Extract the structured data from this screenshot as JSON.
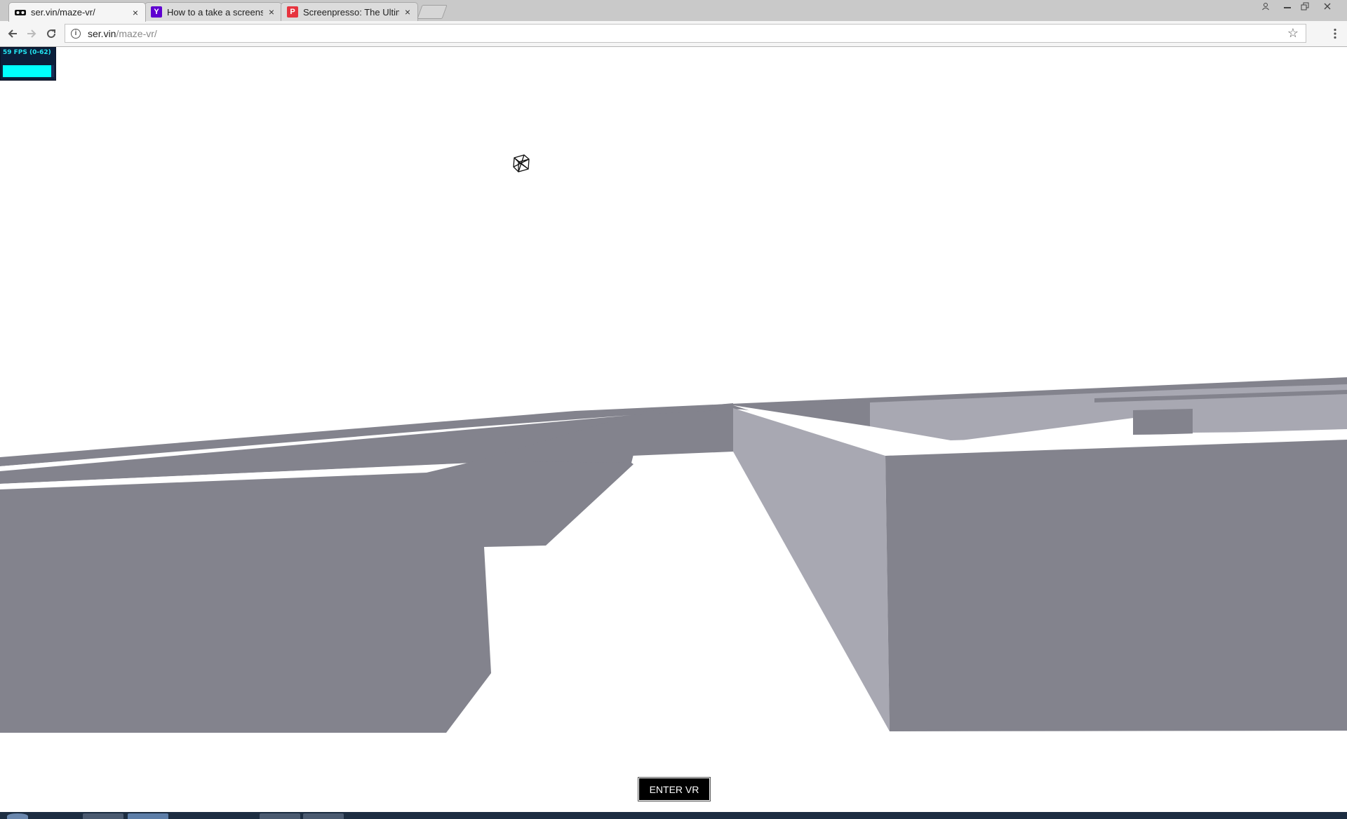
{
  "browser": {
    "tabs": [
      {
        "title": "ser.vin/maze-vr/",
        "favicon": "vr-goggles-icon",
        "active": true
      },
      {
        "title": "How to a take a screensh",
        "favicon": "yahoo-icon",
        "favicon_glyph": "Y",
        "favicon_color": "#5f01d1",
        "active": false
      },
      {
        "title": "Screenpresso: The Ultima",
        "favicon": "screenpresso-icon",
        "favicon_glyph": "P",
        "favicon_color": "#e7343f",
        "active": false
      }
    ],
    "close_glyph": "×",
    "url_host": "ser.vin",
    "url_path": "/maze-vr/"
  },
  "stats": {
    "fps_label": "59 FPS (0-62)",
    "fps_level": 0.95,
    "accent": "#00ffff"
  },
  "scene": {
    "wall_dark": "#83838d",
    "wall_light": "#a8a8b2",
    "floor": "#ffffff"
  },
  "enter_vr_label": "ENTER VR"
}
